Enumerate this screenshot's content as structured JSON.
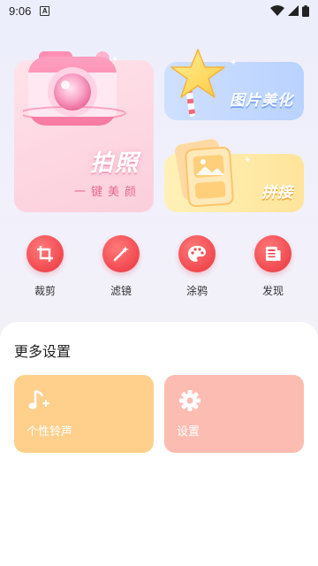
{
  "status_bar": {
    "time": "9:06",
    "notification_letter": "A"
  },
  "hero": {
    "camera_card": {
      "title": "拍照",
      "subtitle": "一键美颜"
    },
    "beauty_card": {
      "label": "图片美化"
    },
    "stitch_card": {
      "label": "拼接"
    }
  },
  "tools": [
    {
      "label": "裁剪",
      "icon": "crop-icon"
    },
    {
      "label": "滤镜",
      "icon": "magic-wand-icon"
    },
    {
      "label": "涂鸦",
      "icon": "palette-icon"
    },
    {
      "label": "发现",
      "icon": "news-icon"
    }
  ],
  "more_settings": {
    "title": "更多设置",
    "items": [
      {
        "label": "个性铃声",
        "icon": "music-note-icon",
        "color": "#fed08c"
      },
      {
        "label": "设置",
        "icon": "gear-icon",
        "color": "#fdbcb1"
      }
    ]
  },
  "colors": {
    "accent_red": "#f0484f",
    "camera_card": "#fdd7e2",
    "beauty_card": "#b9d2ff",
    "stitch_card": "#ffe49a"
  }
}
